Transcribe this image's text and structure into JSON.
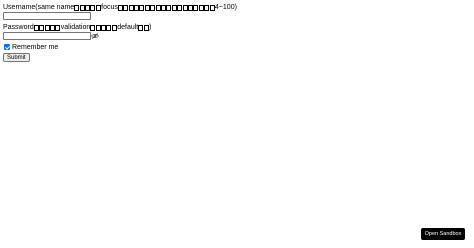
{
  "username": {
    "label_prefix": "Username(same name",
    "label_mid": "focus",
    "label_suffix": "4~100)",
    "value": "",
    "placeholder": ""
  },
  "password": {
    "label_prefix": "Password",
    "label_mid": "validation",
    "label_mid2": "default",
    "label_suffix": ")",
    "value": "",
    "placeholder": "",
    "toggle_icon": "eye-slash-icon"
  },
  "remember": {
    "label": "Remember me",
    "checked": true
  },
  "submit_label": "Submit",
  "sandbox_button_label": "Open Sandbox",
  "colors": {
    "checkbox_accent": "#0075ff",
    "sandbox_bg": "#000000"
  }
}
